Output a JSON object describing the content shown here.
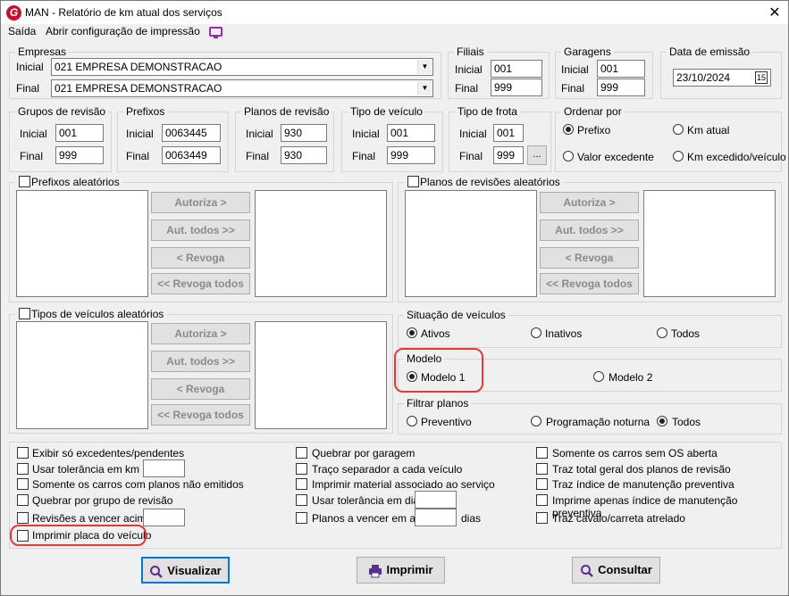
{
  "window": {
    "title": "MAN - Relatório de km atual dos serviços",
    "logo": "G",
    "close": "✕"
  },
  "menu": {
    "exit": "Saída",
    "print_config": "Abrir configuração de impressão"
  },
  "empresas": {
    "label": "Empresas",
    "initial_label": "Inicial",
    "final_label": "Final",
    "initial": "021 EMPRESA DEMONSTRACAO",
    "final": "021 EMPRESA DEMONSTRACAO"
  },
  "filiais": {
    "label": "Filiais",
    "initial_label": "Inicial",
    "final_label": "Final",
    "initial": "001",
    "final": "999"
  },
  "garagens": {
    "label": "Garagens",
    "initial_label": "Inicial",
    "final_label": "Final",
    "initial": "001",
    "final": "999"
  },
  "emissao": {
    "label": "Data de emissão",
    "value": "23/10/2024",
    "cal": "15"
  },
  "grupos": {
    "label": "Grupos de revisão",
    "initial_label": "Inicial",
    "final_label": "Final",
    "initial": "001",
    "final": "999"
  },
  "prefixos": {
    "label": "Prefixos",
    "initial_label": "Inicial",
    "final_label": "Final",
    "initial": "0063445",
    "final": "0063449"
  },
  "planos": {
    "label": "Planos de revisão",
    "initial_label": "Inicial",
    "final_label": "Final",
    "initial": "930",
    "final": "930"
  },
  "tipo_veiculo": {
    "label": "Tipo de veículo",
    "initial_label": "Inicial",
    "final_label": "Final",
    "initial": "001",
    "final": "999"
  },
  "tipo_frota": {
    "label": "Tipo de frota",
    "initial_label": "Inicial",
    "final_label": "Final",
    "initial": "001",
    "final": "999",
    "more": "..."
  },
  "ordenar": {
    "label": "Ordenar por",
    "prefixo": "Prefixo",
    "km_atual": "Km atual",
    "valor_excedente": "Valor excedente",
    "km_excedido": "Km excedido/veículo"
  },
  "transfer": {
    "autoriza": "Autoriza >",
    "aut_todos": "Aut. todos >>",
    "revoga": "< Revoga",
    "revoga_todos": "<< Revoga todos"
  },
  "prefixos_aleatorios": {
    "label": "Prefixos aleatórios"
  },
  "planos_aleatorios": {
    "label": "Planos de revisões aleatórios"
  },
  "tipos_aleatorios": {
    "label": "Tipos de veículos aleatórios"
  },
  "situacao": {
    "label": "Situação de veículos",
    "ativos": "Ativos",
    "inativos": "Inativos",
    "todos": "Todos"
  },
  "modelo": {
    "label": "Modelo",
    "m1": "Modelo 1",
    "m2": "Modelo 2"
  },
  "filtrar": {
    "label": "Filtrar planos",
    "preventivo": "Preventivo",
    "programacao": "Programação noturna",
    "todos": "Todos"
  },
  "options": {
    "c1": [
      "Exibir só excedentes/pendentes",
      "Usar tolerância em km",
      "Somente os carros com planos não emitidos",
      "Quebrar por grupo de revisão",
      "Revisões a vencer acima",
      "Imprimir placa do veículo"
    ],
    "c2": [
      "Quebrar por garagem",
      "Traço separador a cada veículo",
      "Imprimir material associado ao serviço",
      "Usar tolerância em dias",
      "Planos a vencer em até"
    ],
    "dias": "dias",
    "c3": [
      "Somente os carros sem OS aberta",
      "Traz total geral dos planos de revisão",
      "Traz índice de manutenção preventiva",
      "Imprime apenas índice de manutenção preventiva",
      "Traz cavalo/carreta atrelado"
    ]
  },
  "actions": {
    "visualizar": "Visualizar",
    "imprimir": "Imprimir",
    "consultar": "Consultar"
  }
}
